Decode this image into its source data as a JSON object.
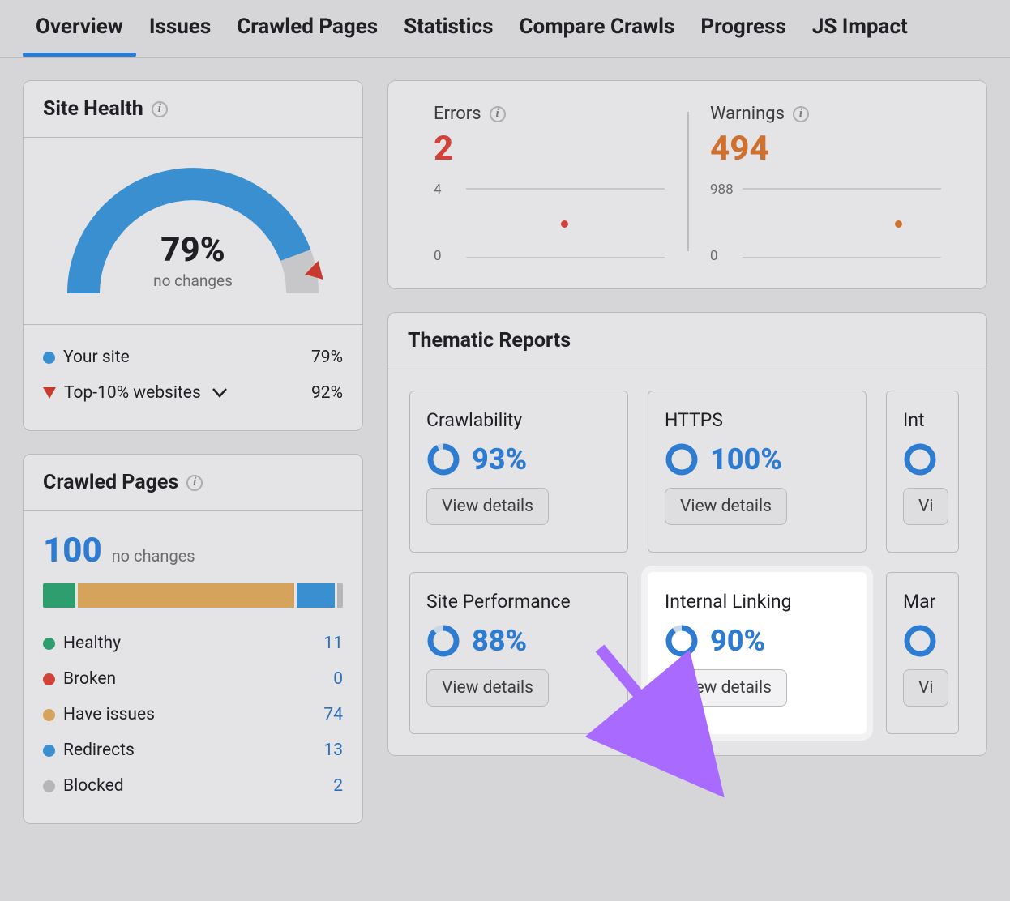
{
  "tabs": [
    "Overview",
    "Issues",
    "Crawled Pages",
    "Statistics",
    "Compare Crawls",
    "Progress",
    "JS Impact"
  ],
  "active_tab": 0,
  "site_health": {
    "title": "Site Health",
    "pct": "79%",
    "sub": "no changes",
    "legend": {
      "your_site_label": "Your site",
      "your_site_val": "79%",
      "top10_label": "Top-10% websites",
      "top10_val": "92%"
    }
  },
  "crawled_pages": {
    "title": "Crawled Pages",
    "total": "100",
    "sub": "no changes",
    "items": [
      {
        "label": "Healthy",
        "val": "11",
        "color": "#2f9e6e",
        "pct": 11
      },
      {
        "label": "Broken",
        "val": "0",
        "color": "#d14338",
        "pct": 0
      },
      {
        "label": "Have issues",
        "val": "74",
        "color": "#d5a35c",
        "pct": 74
      },
      {
        "label": "Redirects",
        "val": "13",
        "color": "#3a8fd1",
        "pct": 13
      },
      {
        "label": "Blocked",
        "val": "2",
        "color": "#b6b6b8",
        "pct": 2
      }
    ]
  },
  "stats": {
    "errors": {
      "label": "Errors",
      "value": "2",
      "ytop": "4",
      "ybot": "0",
      "dot_color": "#d14338"
    },
    "warnings": {
      "label": "Warnings",
      "value": "494",
      "ytop": "988",
      "ybot": "0",
      "dot_color": "#d0702f"
    }
  },
  "thematic": {
    "title": "Thematic Reports",
    "btn_label": "View details",
    "cards": [
      {
        "name": "Crawlability",
        "pct": "93%",
        "ring": 93
      },
      {
        "name": "HTTPS",
        "pct": "100%",
        "ring": 100
      },
      {
        "name": "International SEO",
        "pct": "",
        "ring": 100,
        "cut": true
      },
      {
        "name": "Site Performance",
        "pct": "88%",
        "ring": 88
      },
      {
        "name": "Internal Linking",
        "pct": "90%",
        "ring": 90,
        "highlight": true
      },
      {
        "name": "Markup",
        "pct": "",
        "ring": 100,
        "cut": true
      }
    ]
  }
}
